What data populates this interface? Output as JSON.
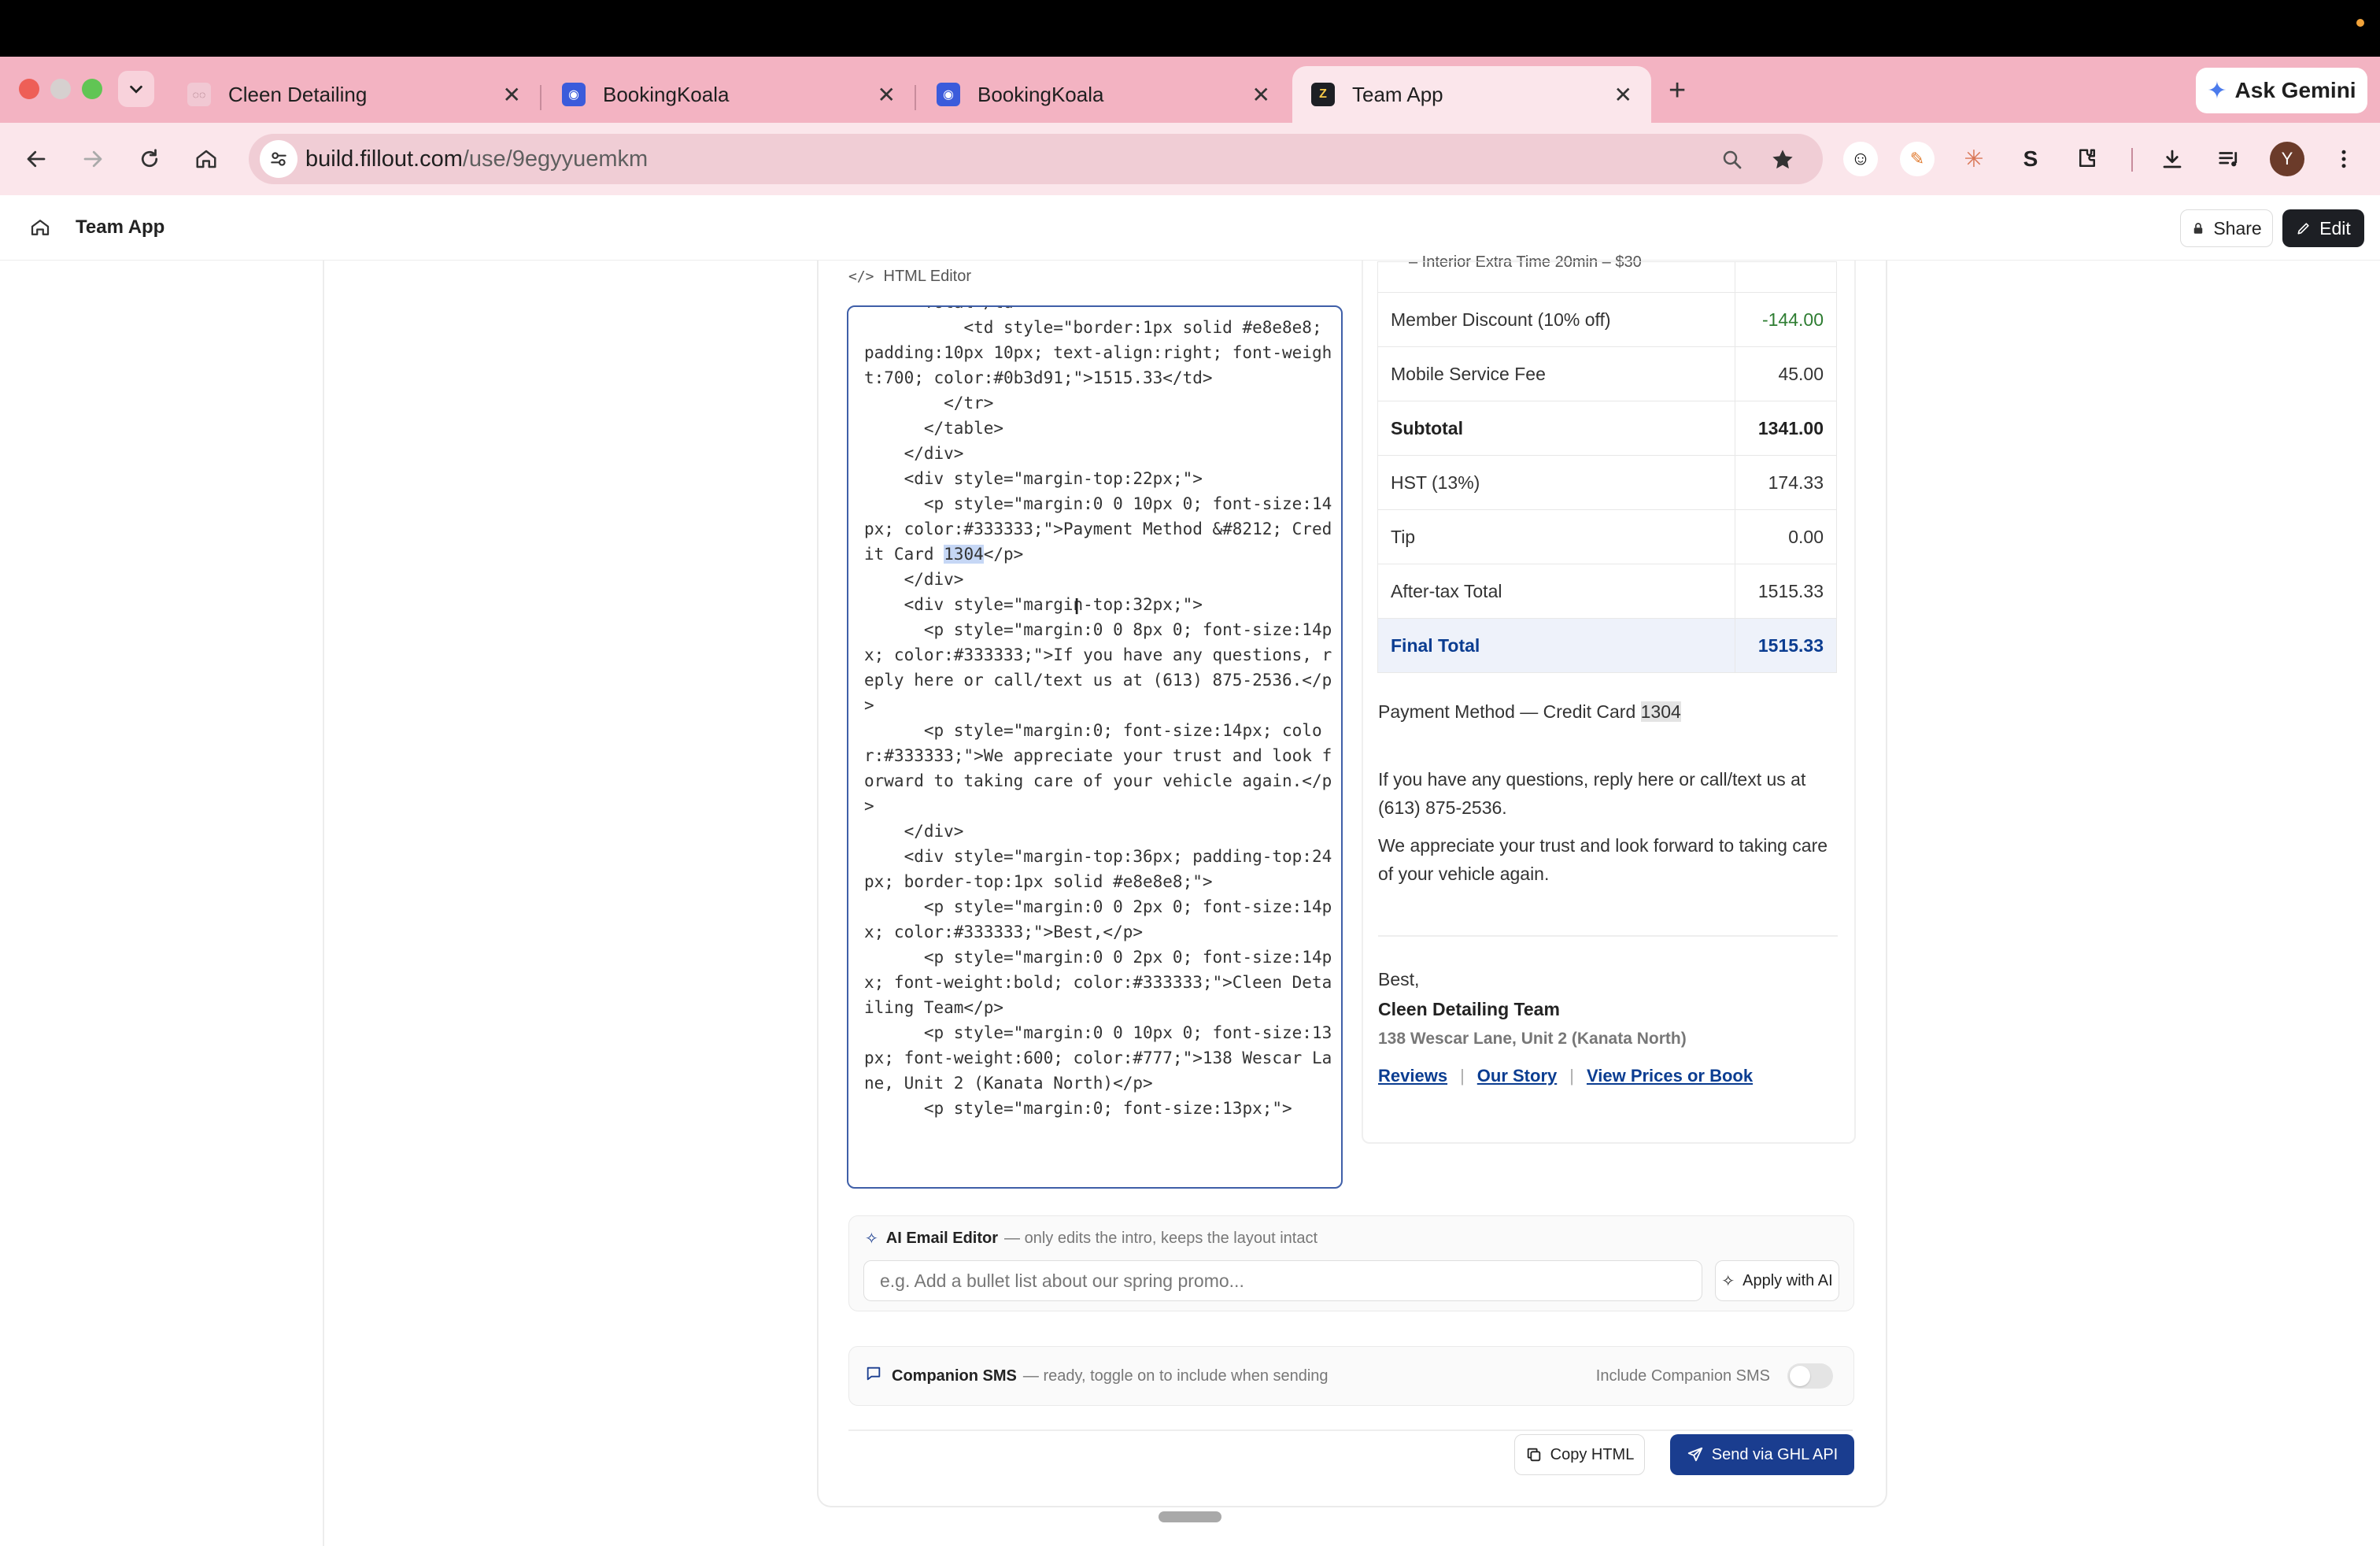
{
  "browser": {
    "tabs": [
      {
        "label": "Cleen Detailing",
        "icon": "cleen-favicon-icon"
      },
      {
        "label": "BookingKoala",
        "icon": "bookingkoala-favicon-icon"
      },
      {
        "label": "BookingKoala",
        "icon": "bookingkoala-favicon-icon"
      },
      {
        "label": "Team App",
        "icon": "fillout-favicon-icon",
        "active": true
      }
    ],
    "close_glyph": "✕",
    "new_tab_glyph": "+",
    "gemini_label": "Ask Gemini",
    "url_host": "build.fillout.com",
    "url_path": "/use/9egyyuemkm",
    "profile_initial": "Y"
  },
  "app": {
    "title": "Team App",
    "share_label": "Share",
    "edit_label": "Edit"
  },
  "editor": {
    "label": "HTML Editor",
    "code_before": "      Total</td>\n          <td style=\"border:1px solid #e8e8e8; padding:10px 10px; text-align:right; font-weight:700; color:#0b3d91;\">1515.33</td>\n        </tr>\n      </table>\n    </div>\n    <div style=\"margin-top:22px;\">\n      <p style=\"margin:0 0 10px 0; font-size:14px; color:#333333;\">Payment Method &#8212; Credit Card ",
    "code_selected": "1304",
    "code_after": "</p>\n    </div>\n    <div style=\"margin-top:32px;\">\n      <p style=\"margin:0 0 8px 0; font-size:14px; color:#333333;\">If you have any questions, reply here or call/text us at (613) 875-2536.</p>\n      <p style=\"margin:0; font-size:14px; color:#333333;\">We appreciate your trust and look forward to taking care of your vehicle again.</p>\n    </div>\n    <div style=\"margin-top:36px; padding-top:24px; border-top:1px solid #e8e8e8;\">\n      <p style=\"margin:0 0 2px 0; font-size:14px; color:#333333;\">Best,</p>\n      <p style=\"margin:0 0 2px 0; font-size:14px; font-weight:bold; color:#333333;\">Cleen Detailing Team</p>\n      <p style=\"margin:0 0 10px 0; font-size:13px; font-weight:600; color:#777;\">138 Wescar Lane, Unit 2 (Kanata North)</p>\n      <p style=\"margin:0; font-size:13px;\">"
  },
  "preview": {
    "cropped_line": "– Interior Extra Time 20min – $30",
    "rows": [
      {
        "label": "Member Discount (10% off)",
        "value": "-144.00"
      },
      {
        "label": "Mobile Service Fee",
        "value": "45.00"
      },
      {
        "label": "Subtotal",
        "value": "1341.00"
      },
      {
        "label": "HST (13%)",
        "value": "174.33"
      },
      {
        "label": "Tip",
        "value": "0.00"
      },
      {
        "label": "After-tax Total",
        "value": "1515.33"
      },
      {
        "label": "Final Total",
        "value": "1515.33"
      }
    ],
    "payment_prefix": "Payment Method — Credit Card",
    "payment_card": "1304",
    "questions": "If you have any questions, reply here or call/text us at (613) 875-2536.",
    "appreciate": "We appreciate your trust and look forward to taking care of your vehicle again.",
    "signoff": "Best,",
    "team": "Cleen Detailing Team",
    "address": "138 Wescar Lane, Unit 2 (Kanata North)",
    "links": [
      "Reviews",
      "Our Story",
      "View Prices or Book"
    ],
    "link_separator": "|"
  },
  "ai_editor": {
    "title": "AI Email Editor",
    "subtitle": "— only edits the intro, keeps the layout intact",
    "placeholder": "e.g. Add a bullet list about our spring promo...",
    "button_label": "Apply with AI"
  },
  "sms": {
    "title": "Companion SMS",
    "subtitle": "— ready, toggle on to include when sending",
    "toggle_label": "Include Companion SMS",
    "toggle_on": false
  },
  "actions": {
    "copy_label": "Copy HTML",
    "send_label": "Send via GHL API"
  },
  "colors": {
    "accent_navy": "#0b3d91",
    "send_button": "#1a3d8f",
    "discount_green": "#2e7d32",
    "tab_strip": "#f3b3c2"
  }
}
